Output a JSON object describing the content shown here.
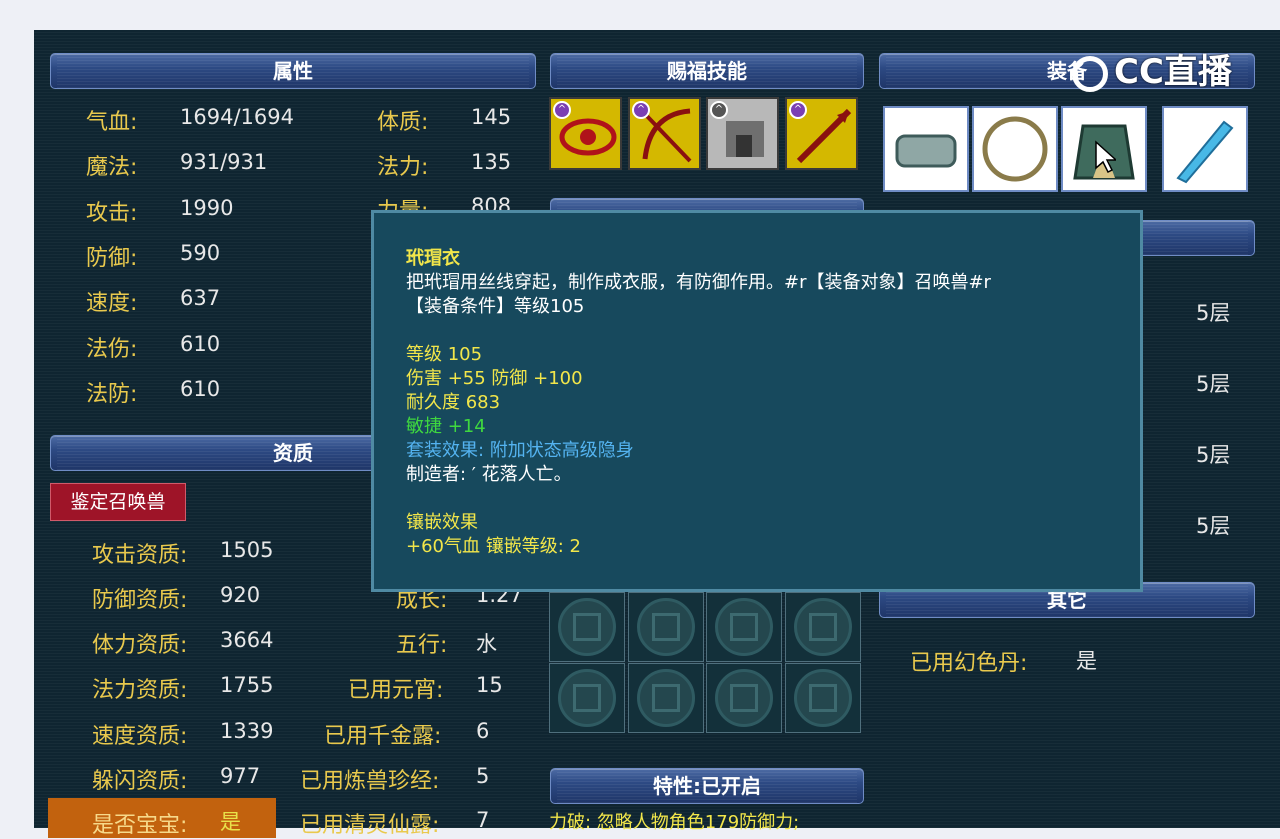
{
  "headers": {
    "attributes": "属性",
    "skills": "赐福技能",
    "equipment": "装备",
    "aptitude": "资质",
    "traits": "特性:已开启",
    "other": "其它"
  },
  "attributes": [
    {
      "label": "气血:",
      "value": "1694/1694"
    },
    {
      "label": "魔法:",
      "value": "931/931"
    },
    {
      "label": "攻击:",
      "value": "1990"
    },
    {
      "label": "防御:",
      "value": "590"
    },
    {
      "label": "速度:",
      "value": "637"
    },
    {
      "label": "法伤:",
      "value": "610"
    },
    {
      "label": "法防:",
      "value": "610"
    }
  ],
  "attributes_right": [
    {
      "label": "体质:",
      "value": "145"
    },
    {
      "label": "法力:",
      "value": "135"
    },
    {
      "label": "力量:",
      "value": "808"
    }
  ],
  "identify_button": "鉴定召唤兽",
  "aptitudes": [
    {
      "label": "攻击资质:",
      "value": "1505"
    },
    {
      "label": "防御资质:",
      "value": "920"
    },
    {
      "label": "体力资质:",
      "value": "3664"
    },
    {
      "label": "法力资质:",
      "value": "1755"
    },
    {
      "label": "速度资质:",
      "value": "1339"
    },
    {
      "label": "躲闪资质:",
      "value": "977"
    },
    {
      "label": "是否宝宝:",
      "value": "是"
    }
  ],
  "aptitudes_right": [
    {
      "label": "成长:",
      "value": "1.27"
    },
    {
      "label": "五行:",
      "value": "水"
    },
    {
      "label": "已用元宵:",
      "value": "15"
    },
    {
      "label": "已用千金露:",
      "value": "6"
    },
    {
      "label": "已用炼兽珍经:",
      "value": "5"
    },
    {
      "label": "已用清灵仙露:",
      "value": "7"
    }
  ],
  "layers": [
    "5层",
    "5层",
    "5层",
    "5层"
  ],
  "other": {
    "label": "已用幻色丹:",
    "value": "是"
  },
  "trait_text": "力破: 忽略人物角色179防御力;",
  "logo_text": "CC直播",
  "tooltip": {
    "name": "玳瑁衣",
    "desc1": "把玳瑁用丝线穿起，制作成衣服，有防御作用。#r【装备对象】召唤兽#r",
    "desc2": "【装备条件】等级105",
    "level": "等级 105",
    "dmg_def": "伤害 +55 防御 +100",
    "durability": "耐久度 683",
    "agility": "敏捷 +14",
    "set_effect": "套装效果: 附加状态高级隐身",
    "maker": "制造者: ′ 花落人亡。",
    "inlay_title": "镶嵌效果",
    "inlay": "+60气血 镶嵌等级: 2"
  },
  "colors": {
    "label": "#e9c94d",
    "value": "#e8e8e8",
    "tooltip_yellow": "#f2e64a",
    "tooltip_green": "#3fd83f",
    "tooltip_blue": "#54b3f0"
  }
}
